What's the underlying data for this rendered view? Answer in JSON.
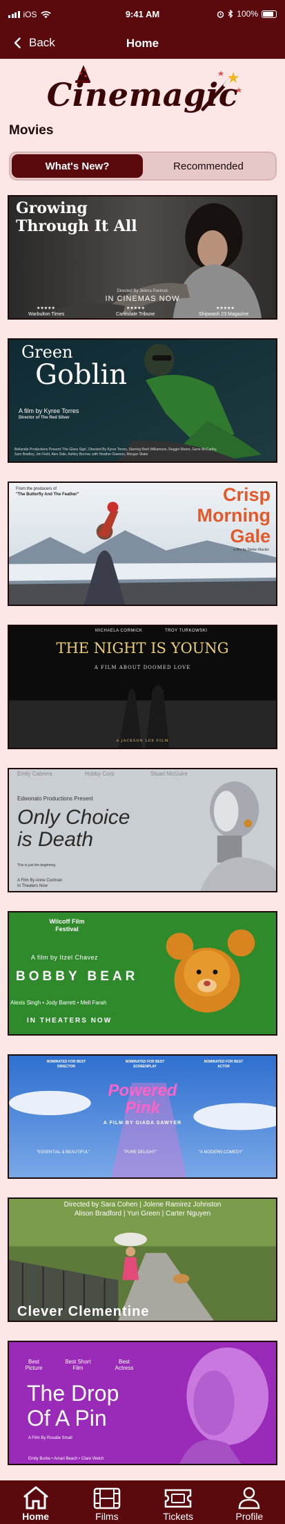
{
  "status_bar": {
    "carrier": "iOS",
    "time": "9:41 AM",
    "battery": "100%"
  },
  "nav": {
    "back_label": "Back",
    "title": "Home"
  },
  "logo": {
    "text": "Cinemagic"
  },
  "section": {
    "title": "Movies"
  },
  "segments": {
    "whats_new": "What's New?",
    "recommended": "Recommended"
  },
  "posters": [
    {
      "title_line1": "Growing",
      "title_line2": "Through It All",
      "director": "Directed By Jelena Pavlovic",
      "tagline": "IN CINEMAS NOW",
      "review1": "Warbulton Times",
      "review2": "Carlisdale Tribune",
      "review3": "Shipwash 23 Magazine",
      "stars": "★★★★★"
    },
    {
      "title_line1": "Green",
      "title_line2": "Goblin",
      "byline": "A film by Kyree Torres",
      "subline": "Director of The Red Silver",
      "credits": "Bellandie Productions Present 'The Glass Sign', Directed By Kyree Torres, Starring Brett Williamson, Reggie Moore, Gene McCarthy, Sam Bradley, Jim Field, Alex Dale, Ashley Borrow, with Heather Dawson, Morgan Slater"
    },
    {
      "from_line": "From the producers of",
      "from_title": "\"The Butterfly And The Feather\"",
      "title_line1": "Crisp",
      "title_line2": "Morning",
      "title_line3": "Gale",
      "byline": "a film by Stefan Mackie"
    },
    {
      "actor1": "MICHAELA CORMICK",
      "actor2": "TROY TURKOWSKI",
      "title": "THE NIGHT IS YOUNG",
      "subtitle": "A FILM ABOUT DOOMED LOVE",
      "credit": "A JACKSON LEE FILM"
    },
    {
      "actor1": "Emily Cabrera",
      "actor2": "Hobby Corp",
      "actor3": "Stuart McGuire",
      "presents": "Edwonato Productions Present",
      "title_line1": "Only Choice",
      "title_line2": "is Death",
      "tagline": "This is just the beginning.",
      "byline": "A Film By Anne Cochran",
      "release": "In Theaters Now"
    },
    {
      "laurel": "Wilcoff Film Festival",
      "byline": "A film by Itzel Chavez",
      "title": "BOBBY BEAR",
      "cast": "Alexis Singh • Jody Barrett • Mell Farah",
      "release": "IN THEATERS NOW"
    },
    {
      "award1": "NOMINATED FOR BEST DIRECTOR",
      "award2": "NOMINATED FOR BEST SCREENPLAY",
      "award3": "NOMINATED FOR BEST ACTOR",
      "title_line1": "Powered",
      "title_line2": "Pink",
      "byline": "A FILM BY GIADA SAWYER",
      "quote1": "\"ESSENTIAL & BEAUTIFUL\"",
      "quote2": "\"PURE DELIGHT\"",
      "quote3": "\"A MODERN COMEDY\""
    },
    {
      "credits_line1": "Directed by Sara Cohen | Jolene Ramirez Johnston",
      "credits_line2": "Alison Bradford | Yuri Green | Carter Nguyen",
      "title": "Clever Clementine"
    },
    {
      "award1": "Best Picture",
      "award2": "Best Short Film",
      "award3": "Best Actress",
      "title_line1": "The Drop",
      "title_line2": "Of A Pin",
      "byline": "A Film By Rosalie Small",
      "cast": "Emily Burke • Amari Beach • Clare Welch"
    }
  ],
  "tabs": {
    "home": "Home",
    "films": "Films",
    "tickets": "Tickets",
    "profile": "Profile"
  },
  "colors": {
    "brand": "#5a0a0c",
    "background": "#fde6e6",
    "segment_bg": "#e7c8c8"
  }
}
